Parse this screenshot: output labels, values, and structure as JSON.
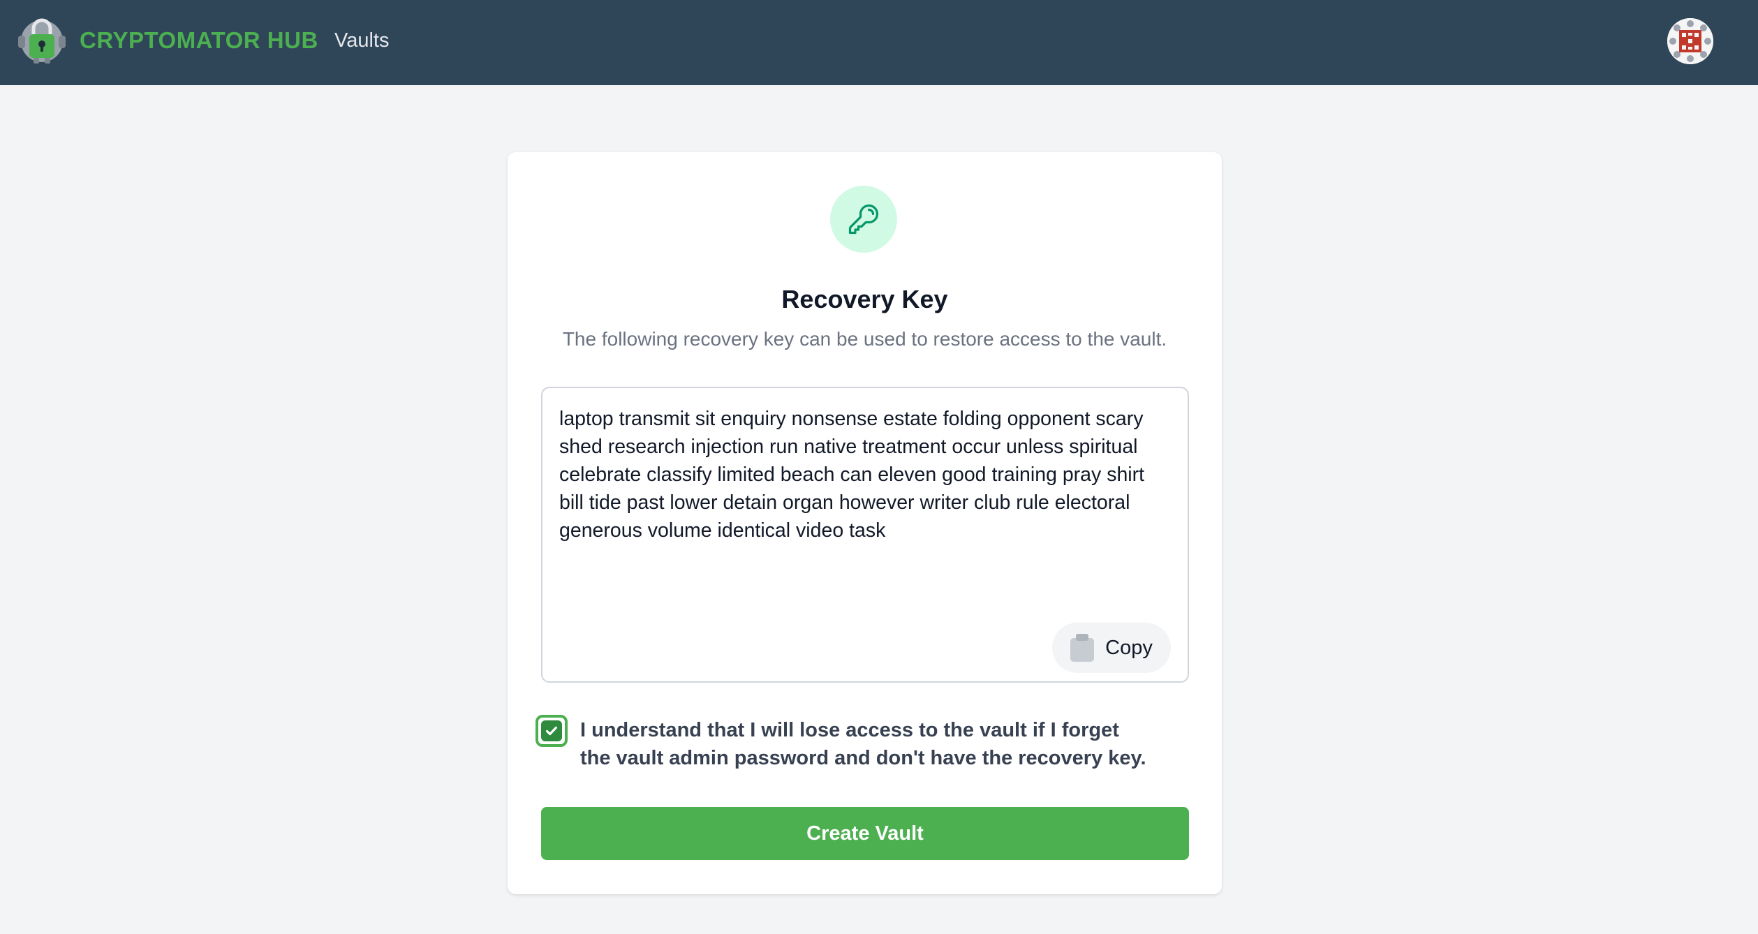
{
  "header": {
    "brand_name": "CRYPTOMATOR HUB",
    "nav": {
      "vaults_label": "Vaults"
    },
    "logo_icon": "cryptomator-bot-lock-icon",
    "avatar_icon": "user-avatar-identicon"
  },
  "recovery": {
    "icon": "key-icon",
    "title": "Recovery Key",
    "subtitle": "The following recovery key can be used to restore access to the vault.",
    "key_text": "laptop transmit sit enquiry nonsense estate folding opponent scary shed research injection run native treatment occur unless spiritual celebrate classify limited beach can eleven good training pray shirt bill tide past lower detain organ however writer club rule electoral generous volume identical video task",
    "copy_button": {
      "label": "Copy",
      "icon": "clipboard-icon"
    },
    "consent": {
      "checked": true,
      "label": "I understand that I will lose access to the vault if I forget the vault admin password and don't have the recovery key."
    },
    "create_button_label": "Create Vault"
  },
  "colors": {
    "header_bg": "#2f4659",
    "brand_green": "#4caf50",
    "page_bg": "#f3f4f6",
    "key_circle_bg": "#d1fae5",
    "key_icon": "#059669"
  }
}
